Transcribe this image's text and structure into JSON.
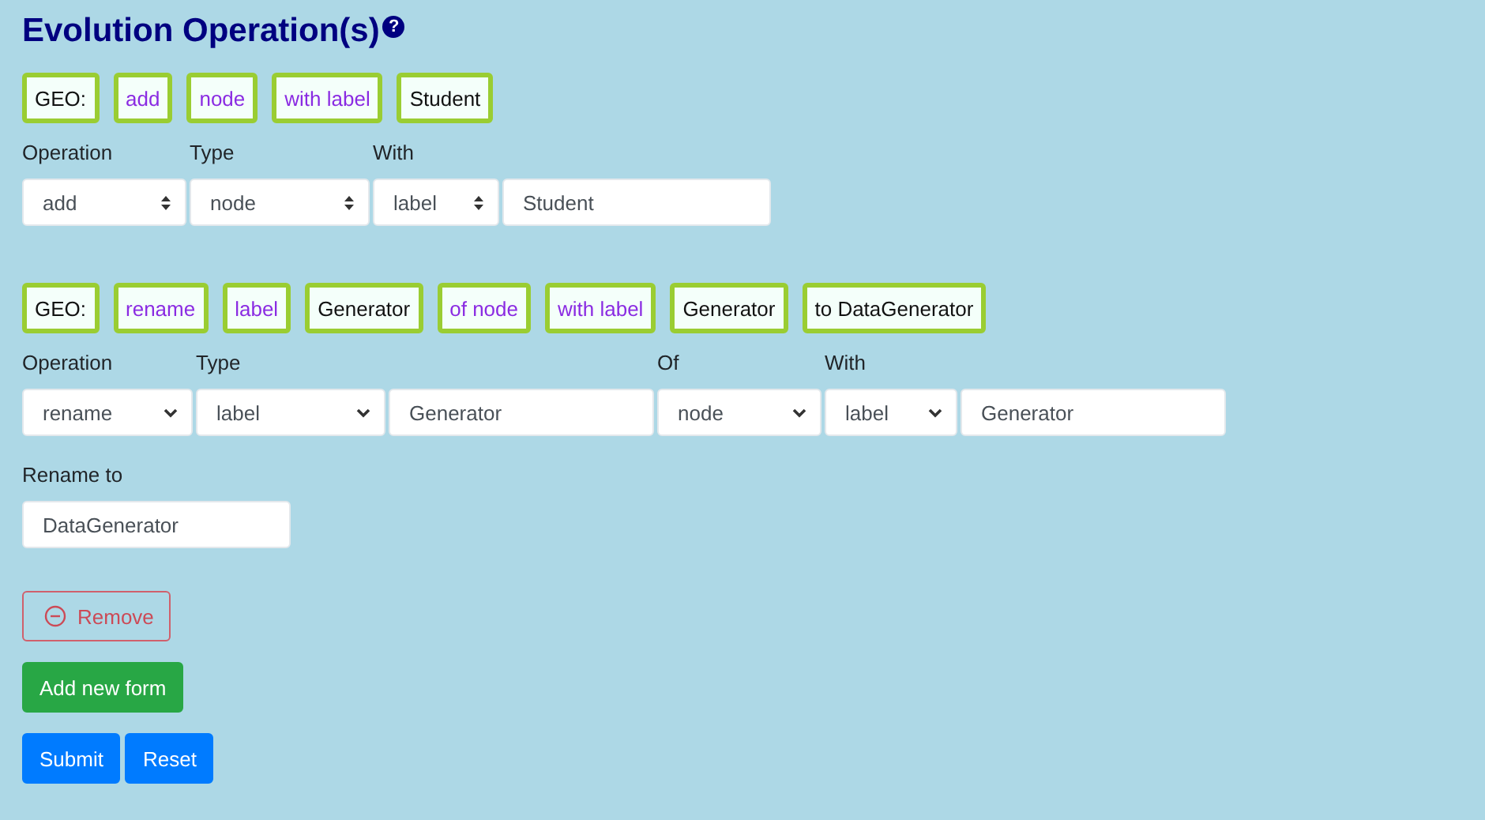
{
  "header": {
    "title": "Evolution Operation(s)",
    "help": "?"
  },
  "forms": [
    {
      "tokens": [
        {
          "text": "GEO:",
          "kind": "plain"
        },
        {
          "text": "add",
          "kind": "keyword"
        },
        {
          "text": "node",
          "kind": "keyword"
        },
        {
          "text": "with label",
          "kind": "keyword"
        },
        {
          "text": "Student",
          "kind": "plain"
        }
      ],
      "fields": [
        {
          "kind": "updown",
          "label": "Operation",
          "value": "add"
        },
        {
          "kind": "updown",
          "label": "Type",
          "value": "node"
        },
        {
          "kind": "updown",
          "label": "With",
          "value": "label"
        },
        {
          "kind": "text",
          "value": "Student"
        }
      ]
    },
    {
      "tokens": [
        {
          "text": "GEO:",
          "kind": "plain"
        },
        {
          "text": "rename",
          "kind": "keyword"
        },
        {
          "text": "label",
          "kind": "keyword"
        },
        {
          "text": "Generator",
          "kind": "plain"
        },
        {
          "text": "of node",
          "kind": "keyword"
        },
        {
          "text": "with label",
          "kind": "keyword"
        },
        {
          "text": "Generator",
          "kind": "plain"
        },
        {
          "text": "to DataGenerator",
          "kind": "plain"
        }
      ],
      "fields": [
        {
          "kind": "dropdown",
          "label": "Operation",
          "value": "rename"
        },
        {
          "kind": "dropdown",
          "label": "Type",
          "value": "label"
        },
        {
          "kind": "text",
          "value": "Generator"
        },
        {
          "kind": "dropdown",
          "label": "Of",
          "value": "node"
        },
        {
          "kind": "dropdown",
          "label": "With",
          "value": "label"
        },
        {
          "kind": "text",
          "value": "Generator"
        }
      ],
      "extra_fields": [
        {
          "kind": "text",
          "label": "Rename to",
          "value": "DataGenerator"
        }
      ]
    }
  ],
  "actions": [
    [
      {
        "text": "Remove",
        "kind": "outline-danger"
      }
    ],
    [
      {
        "text": "Add new form",
        "kind": "success"
      }
    ],
    [
      {
        "text": "Submit",
        "kind": "primary"
      },
      {
        "text": "Reset",
        "kind": "primary"
      }
    ]
  ]
}
